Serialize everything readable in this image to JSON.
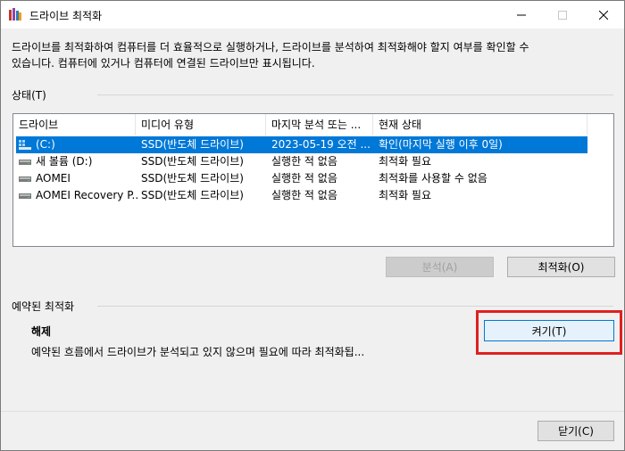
{
  "window": {
    "title": "드라이브 최적화",
    "controls": {
      "minimize": "minimize",
      "maximize": "maximize",
      "close": "close"
    }
  },
  "description": {
    "line1": "드라이브를 최적화하여 컴퓨터를 더 효율적으로 실행하거나, 드라이브를 분석하여 최적화해야 할지 여부를 확인할 수",
    "line2": "있습니다. 컴퓨터에 있거나 컴퓨터에 연결된 드라이브만 표시됩니다."
  },
  "status_section": {
    "label": "상태(T)",
    "columns": [
      "드라이브",
      "미디어 유형",
      "마지막 분석 또는 ...",
      "현재 상태"
    ],
    "rows": [
      {
        "drive": "(C:)",
        "media": "SSD(반도체 드라이브)",
        "last": "2023-05-19 오전 ...",
        "status": "확인(마지막 실행 이후 0일)",
        "icon": "windows-drive-icon",
        "selected": true
      },
      {
        "drive": "새 볼륨 (D:)",
        "media": "SSD(반도체 드라이브)",
        "last": "실행한 적 없음",
        "status": "최적화 필요",
        "icon": "drive-icon",
        "selected": false
      },
      {
        "drive": "AOMEI",
        "media": "SSD(반도체 드라이브)",
        "last": "실행한 적 없음",
        "status": "최적화를 사용할 수 없음",
        "icon": "drive-icon",
        "selected": false
      },
      {
        "drive": "AOMEI Recovery P...",
        "media": "SSD(반도체 드라이브)",
        "last": "실행한 적 없음",
        "status": "최적화 필요",
        "icon": "drive-icon",
        "selected": false
      }
    ],
    "analyze_button": "분석(A)",
    "optimize_button": "최적화(O)"
  },
  "scheduled_section": {
    "label": "예약된 최적화",
    "status": "해제",
    "description": "예약된 흐름에서 드라이브가 분석되고 있지 않으며 필요에 따라 최적화됩...",
    "turn_on_button": "켜기(T)"
  },
  "footer": {
    "close_button": "닫기(C)"
  },
  "colors": {
    "selection": "#0078d7",
    "highlight_box": "#e02020"
  }
}
